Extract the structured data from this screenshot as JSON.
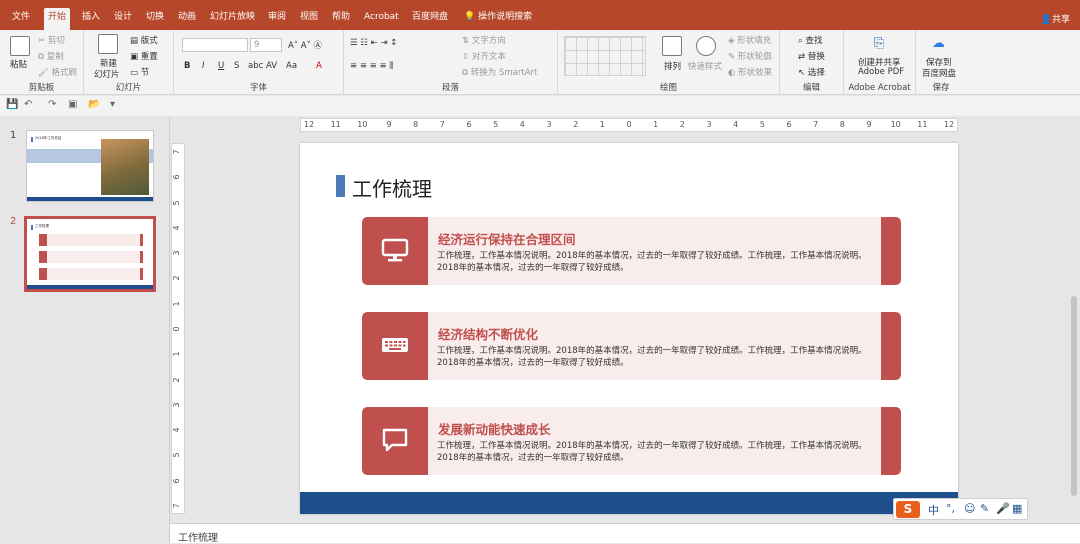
{
  "menu": {
    "tabs": [
      "文件",
      "开始",
      "插入",
      "设计",
      "切换",
      "动画",
      "幻灯片放映",
      "审阅",
      "视图",
      "帮助",
      "Acrobat",
      "百度网盘"
    ],
    "active_tab": "开始",
    "search_label": "操作说明搜索",
    "share_label": "共享"
  },
  "ribbon": {
    "clipboard": {
      "label": "剪贴板",
      "paste": "粘贴",
      "cut": "剪切",
      "copy": "复制",
      "format_painter": "格式刷"
    },
    "slides": {
      "label": "幻灯片",
      "new_slide": "新建",
      "new_slide_2": "幻灯片",
      "layout": "版式",
      "reset": "重置",
      "section": "节"
    },
    "font": {
      "label": "字体",
      "font_size": "9"
    },
    "paragraph": {
      "label": "段落",
      "text_direction": "文字方向",
      "align_text": "对齐文本",
      "smartart": "转换为 SmartArt"
    },
    "drawing": {
      "label": "绘图",
      "arrange": "排列",
      "quick_styles": "快速样式",
      "fill": "形状填充",
      "outline": "形状轮廓",
      "effects": "形状效果"
    },
    "editing": {
      "label": "编辑",
      "find": "查找",
      "replace": "替换",
      "select": "选择"
    },
    "acrobat": {
      "label": "Adobe Acrobat",
      "create_1": "创建并共享",
      "create_2": "Adobe PDF"
    },
    "save": {
      "label": "保存",
      "save_1": "保存到",
      "save_2": "百度网盘"
    }
  },
  "thumbnails": [
    {
      "number": "1",
      "title": "2018年工作总结",
      "selected": false
    },
    {
      "number": "2",
      "title": "工作梳理",
      "selected": true
    }
  ],
  "hruler_labels": [
    "12",
    "11",
    "10",
    "9",
    "8",
    "7",
    "6",
    "5",
    "4",
    "3",
    "2",
    "1",
    "0",
    "1",
    "2",
    "3",
    "4",
    "5",
    "6",
    "7",
    "8",
    "9",
    "10",
    "11",
    "12"
  ],
  "vruler_labels": [
    "7",
    "6",
    "5",
    "4",
    "3",
    "2",
    "1",
    "0",
    "1",
    "2",
    "3",
    "4",
    "5",
    "6",
    "7"
  ],
  "slide": {
    "title": "工作梳理",
    "cards": [
      {
        "icon": "monitor-icon",
        "heading": "经济运行保持在合理区间",
        "body": "工作梳理，工作基本情况说明。2018年的基本情况，过去的一年取得了较好成绩。工作梳理，工作基本情况说明。2018年的基本情况，过去的一年取得了较好成绩。"
      },
      {
        "icon": "keyboard-icon",
        "heading": "经济结构不断优化",
        "body": "工作梳理，工作基本情况说明。2018年的基本情况，过去的一年取得了较好成绩。工作梳理，工作基本情况说明。2018年的基本情况，过去的一年取得了较好成绩。"
      },
      {
        "icon": "chat-bubble-icon",
        "heading": "发展新动能快速成长",
        "body": "工作梳理，工作基本情况说明。2018年的基本情况，过去的一年取得了较好成绩。工作梳理，工作基本情况说明。2018年的基本情况，过去的一年取得了较好成绩。"
      }
    ],
    "colors": {
      "accent": "#c0504d",
      "card_bg": "#f8ecec",
      "title_bar": "#4e7ab5",
      "footer": "#1f4e8c"
    }
  },
  "ime": {
    "mode": "中"
  },
  "notes": {
    "text": "工作梳理"
  }
}
